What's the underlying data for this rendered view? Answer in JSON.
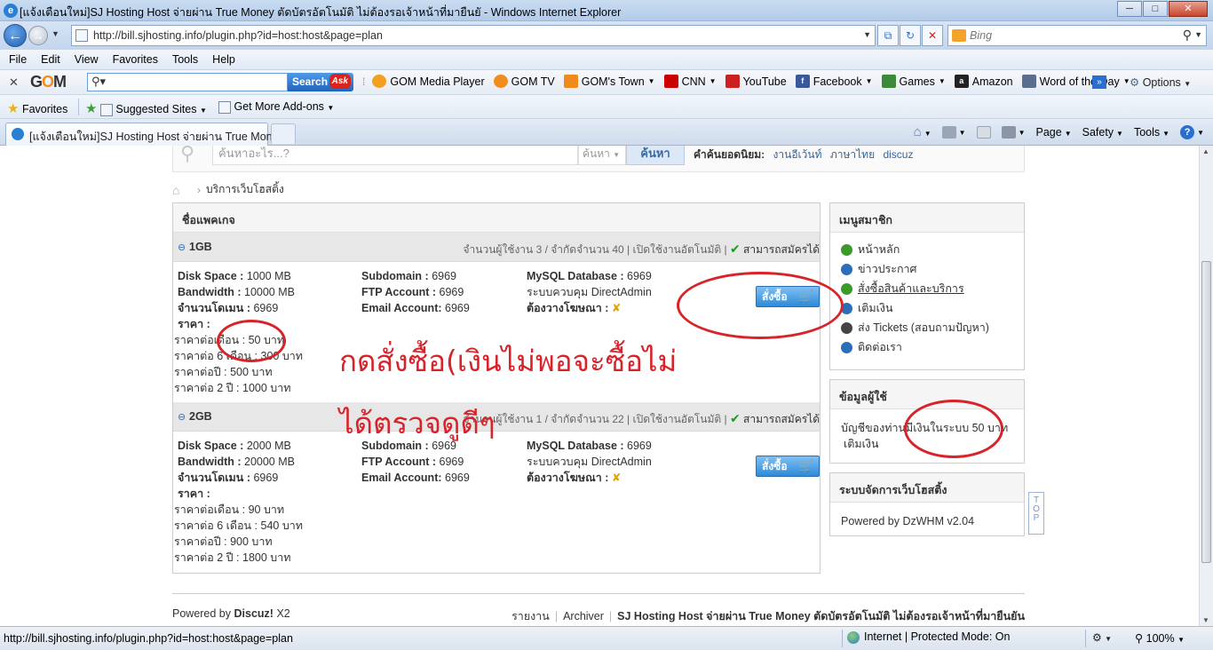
{
  "window": {
    "title": "[แจ้งเตือนใหม่]SJ Hosting Host จ่ายผ่าน True Money ตัดบัตรอัตโนมัติ ไม่ต้องรอเจ้าหน้าที่มายืนยั - Windows Internet Explorer",
    "minimize": "─",
    "maximize": "□",
    "close": "✕"
  },
  "address": {
    "url": "http://bill.sjhosting.info/plugin.php?id=host:host&page=plan",
    "search_placeholder": "Bing"
  },
  "menubar": [
    "File",
    "Edit",
    "View",
    "Favorites",
    "Tools",
    "Help"
  ],
  "gom": {
    "logo_g": "G",
    "logo_o": "O",
    "logo_m": "M",
    "search_button": "Search",
    "ask": "Ask",
    "links": [
      {
        "label": "GOM Media Player",
        "icon": "gom-player-icon",
        "color": "#f3a020"
      },
      {
        "label": "GOM TV",
        "icon": "gom-tv-icon",
        "color": "#f28c1b"
      },
      {
        "label": "GOM's Town",
        "icon": "rss-icon",
        "color": "#f08a1c",
        "dropdown": true
      },
      {
        "label": "CNN",
        "icon": "cnn-icon",
        "color": "#cc0000",
        "dropdown": true
      },
      {
        "label": "YouTube",
        "icon": "youtube-icon",
        "color": "#cc2020"
      },
      {
        "label": "Facebook",
        "icon": "facebook-icon",
        "color": "#3b5998",
        "dropdown": true
      },
      {
        "label": "Games",
        "icon": "games-icon",
        "color": "#3a8a3a",
        "dropdown": true
      },
      {
        "label": "Amazon",
        "icon": "amazon-icon",
        "color": "#222222"
      },
      {
        "label": "Word of the Day",
        "icon": "word-icon",
        "color": "#5b6e8e",
        "dropdown": true
      }
    ],
    "options": "Options"
  },
  "favorites": {
    "favorites_label": "Favorites",
    "suggested": "Suggested Sites",
    "addons": "Get More Add-ons"
  },
  "tab": {
    "label": "[แจ้งเตือนใหม่]SJ Hosting Host จ่ายผ่าน True Mone..."
  },
  "commands": [
    "Page",
    "Safety",
    "Tools"
  ],
  "page": {
    "search_placeholder": "ค้นหาอะไร...?",
    "search_category": "ค้นหา",
    "search_button": "ค้นหา",
    "hot_label": "คำค้นยอดนิยม:",
    "hot_words": [
      "งานอีเว้นท์",
      "ภาษาไทย",
      "discuz"
    ],
    "breadcrumb": "บริการเว็บโฮสติ้ง",
    "packages_header": "ชื่อแพคเกจ",
    "status_enabled": "สามารถสมัครได้",
    "auto_open": "เปิดใช้งานอัตโนมัติ",
    "packages": [
      {
        "name": "1GB",
        "users_text": "จำนวนผู้ใช้งาน 3 / จำกัดจำนวน 40",
        "disk": "1000 MB",
        "bandwidth": "10000 MB",
        "domains": "6969",
        "subdomain": "6969",
        "ftp": "6969",
        "email": "6969",
        "mysql": "6969",
        "panel": "DirectAdmin",
        "price_month": "ราคาต่อเดือน : 50 บาท",
        "price_6": "ราคาต่อ 6 เดือน : 300 บาท",
        "price_year": "ราคาต่อปี : 500 บาท",
        "price_2y": "ราคาต่อ 2 ปี : 1000 บาท"
      },
      {
        "name": "2GB",
        "users_text": "จำนวนผู้ใช้งาน 1 / จำกัดจำนวน 22",
        "disk": "2000 MB",
        "bandwidth": "20000 MB",
        "domains": "6969",
        "subdomain": "6969",
        "ftp": "6969",
        "email": "6969",
        "mysql": "6969",
        "panel": "DirectAdmin",
        "price_month": "ราคาต่อเดือน : 90 บาท",
        "price_6": "ราคาต่อ 6 เดือน : 540 บาท",
        "price_year": "ราคาต่อปี : 900 บาท",
        "price_2y": "ราคาต่อ 2 ปี : 1800 บาท"
      }
    ],
    "labels": {
      "disk": "Disk Space :",
      "bandwidth": "Bandwidth :",
      "domains": "จำนวนโดเมน :",
      "price": "ราคา :",
      "subdomain": "Subdomain :",
      "ftp": "FTP Account :",
      "email": "Email Account:",
      "mysql": "MySQL Database :",
      "panel": "ระบบควบคุม",
      "ads": "ต้องวางโฆษณา :",
      "order": "สั่งซื้อ"
    },
    "member_menu_header": "เมนูสมาชิก",
    "member_menu": [
      {
        "label": "หน้าหลัก",
        "color": "#3c9a2a"
      },
      {
        "label": "ข่าวประกาศ",
        "color": "#2a6fb8"
      },
      {
        "label": "สั่งซื้อสินค้าและบริการ",
        "color": "#3c9a2a"
      },
      {
        "label": "เติมเงิน",
        "color": "#2a6fb8"
      },
      {
        "label": "ส่ง Tickets (สอบถามปัญหา)",
        "color": "#444444"
      },
      {
        "label": "ติดต่อเรา",
        "color": "#2a6fb8"
      }
    ],
    "user_info_header": "ข้อมูลผู้ใช้",
    "user_balance": "บัญชีของท่านมีเงินในระบบ 50 บาท",
    "topup": "เติมเงิน",
    "mgmt_header": "ระบบจัดการเว็บโฮสติ้ง",
    "powered_by_dzwhm": "Powered by DzWHM v2.04",
    "top_button": [
      "T",
      "O",
      "P"
    ],
    "footer_powered_prefix": "Powered by",
    "footer_discuz": "Discuz!",
    "footer_version": "X2",
    "footer_links": [
      "รายงาน",
      "Archiver"
    ],
    "footer_site": "SJ Hosting Host จ่ายผ่าน True Money ตัดบัตรอัตโนมัติ ไม่ต้องรอเจ้าหน้าที่มายืนยัน",
    "annotation_line1": "กดสั่งซื้อ(เงินไม่พอจะซื้อไม่",
    "annotation_line2": "ได้ตรวจดูดีๆ"
  },
  "statusbar": {
    "url": "http://bill.sjhosting.info/plugin.php?id=host:host&page=plan",
    "zone": "Internet | Protected Mode: On",
    "zoom": "100%"
  },
  "colors": {
    "annotation": "#d8232a",
    "accent": "#2e8ad8"
  }
}
